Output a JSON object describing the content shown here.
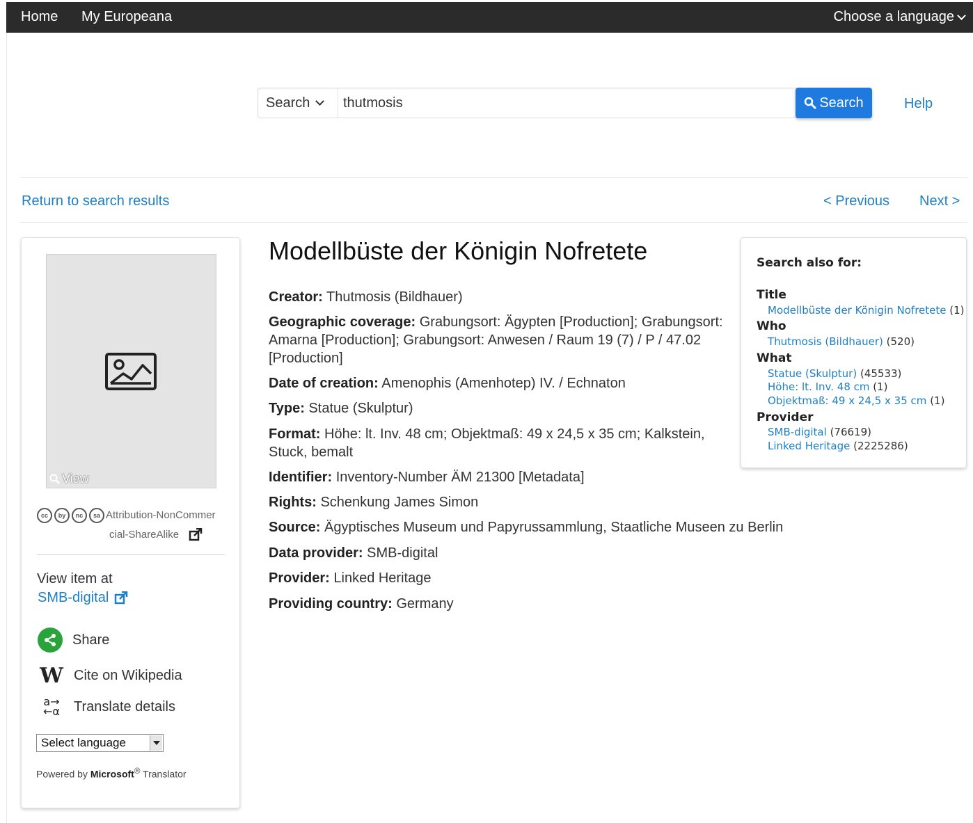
{
  "nav": {
    "home": "Home",
    "my_europeana": "My Europeana",
    "language": "Choose a language"
  },
  "search": {
    "type_label": "Search",
    "query": "thutmosis",
    "button_label": "Search",
    "help": "Help"
  },
  "pager": {
    "return": "Return to search results",
    "previous": "< Previous",
    "next": "Next >"
  },
  "item": {
    "title": "Modellbüste der Königin Nofretete",
    "fields": [
      {
        "label": "Creator:",
        "value": "Thutmosis (Bildhauer)"
      },
      {
        "label": "Geographic coverage:",
        "value": "Grabungsort: Ägypten [Production]; Grabungsort: Amarna [Production]; Grabungsort: Anwesen / Raum 19 (7) / P / 47.02 [Production]"
      },
      {
        "label": "Date of creation:",
        "value": "Amenophis (Amenhotep) IV. / Echnaton"
      },
      {
        "label": "Type:",
        "value": "Statue (Skulptur)"
      },
      {
        "label": "Format:",
        "value": "Höhe: lt. Inv. 48 cm; Objektmaß: 49 x 24,5 x 35 cm; Kalkstein, Stuck, bemalt"
      },
      {
        "label": "Identifier:",
        "value": "Inventory-Number ÄM 21300 [Metadata]"
      },
      {
        "label": "Rights:",
        "value": "Schenkung James Simon"
      },
      {
        "label": "Source:",
        "value": "Ägyptisches Museum und Papyrussammlung, Staatliche Museen zu Berlin"
      },
      {
        "label": "Data provider:",
        "value": "SMB-digital"
      },
      {
        "label": "Provider:",
        "value": "Linked Heritage"
      },
      {
        "label": "Providing country:",
        "value": "Germany"
      }
    ]
  },
  "sidebar": {
    "view_label": "View",
    "cc_icons": [
      "cc",
      "by",
      "nc",
      "sa"
    ],
    "license_line1": "Attribution-NonCommer",
    "license_line2": "cial-ShareAlike",
    "view_item_at": "View item at",
    "provider_link": "SMB-digital",
    "share": "Share",
    "cite": "Cite on Wikipedia",
    "translate": "Translate details",
    "select_language": "Select language",
    "powered_prefix": "Powered by ",
    "powered_brand": "Microsoft",
    "powered_reg": "®",
    "powered_suffix": " Translator"
  },
  "search_also": {
    "title": "Search also for:",
    "groups": [
      {
        "heading": "Title",
        "items": [
          {
            "link": "Modellbüste der Königin Nofretete",
            "count": "(1)"
          }
        ]
      },
      {
        "heading": "Who",
        "items": [
          {
            "link": "Thutmosis (Bildhauer)",
            "count": "(520)"
          }
        ]
      },
      {
        "heading": "What",
        "items": [
          {
            "link": "Statue (Skulptur)",
            "count": "(45533)"
          },
          {
            "link": "Höhe: lt. Inv. 48 cm",
            "count": "(1)"
          },
          {
            "link": "Objektmaß: 49 x 24,5 x 35 cm",
            "count": "(1)"
          }
        ]
      },
      {
        "heading": "Provider",
        "items": [
          {
            "link": "SMB-digital",
            "count": "(76619)"
          },
          {
            "link": "Linked Heritage",
            "count": "(2225286)"
          }
        ]
      }
    ]
  },
  "colors": {
    "nav_bg": "#2b2b2b",
    "link": "#1f7fc4",
    "search_button": "#1f7ae0",
    "share_green": "#2aa33a"
  }
}
